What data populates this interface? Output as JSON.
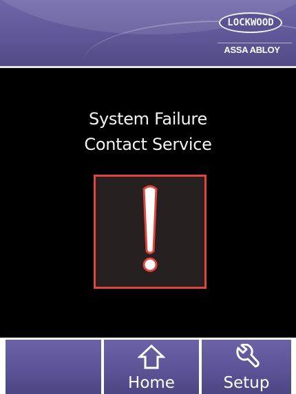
{
  "header": {
    "logo_text": "LOCKWOOD",
    "logo_subtext": "ASSA ABLOY"
  },
  "message": {
    "line1": "System Failure",
    "line2": "Contact Service"
  },
  "alert": {
    "icon": "exclamation-icon"
  },
  "footer": {
    "buttons": [
      {
        "label": "",
        "icon": ""
      },
      {
        "label": "Home",
        "icon": "home-icon"
      },
      {
        "label": "Setup",
        "icon": "wrench-icon"
      }
    ]
  },
  "colors": {
    "header_purple": "#5f5797",
    "alert_red": "#e2453c",
    "background": "#000000",
    "text": "#f4f4f4"
  }
}
